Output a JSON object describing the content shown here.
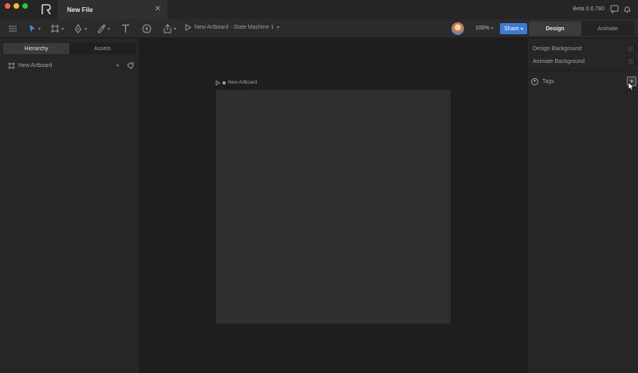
{
  "window": {
    "tab_title": "New File",
    "version": "Beta 0.6.780"
  },
  "toolbar": {
    "breadcrumb": "New Artboard - State Machine 1",
    "zoom": "100%",
    "share_label": "Share",
    "modes": [
      {
        "label": "Design",
        "active": true
      },
      {
        "label": "Animate",
        "active": false
      }
    ]
  },
  "left_panel": {
    "tabs": [
      {
        "label": "Hierarchy",
        "active": true
      },
      {
        "label": "Assets",
        "active": false
      }
    ],
    "hierarchy": [
      {
        "label": "New Artboard"
      }
    ]
  },
  "canvas": {
    "artboard_name": "New Artboard"
  },
  "right_panel": {
    "design_background_label": "Design Background",
    "animate_background_label": "Animate Background",
    "tags_label": "Tags"
  },
  "colors": {
    "accent": "#3d7bd6",
    "background": "#1e1e1e",
    "panel": "#262626",
    "artboard": "#2f2f2f"
  },
  "icons": [
    "menu-icon",
    "select-arrow-icon",
    "frame-icon",
    "pen-icon",
    "paint-icon",
    "text-icon",
    "bolt-icon",
    "export-icon",
    "play-icon",
    "comment-icon",
    "bell-icon",
    "tag-icon",
    "artboard-icon"
  ]
}
